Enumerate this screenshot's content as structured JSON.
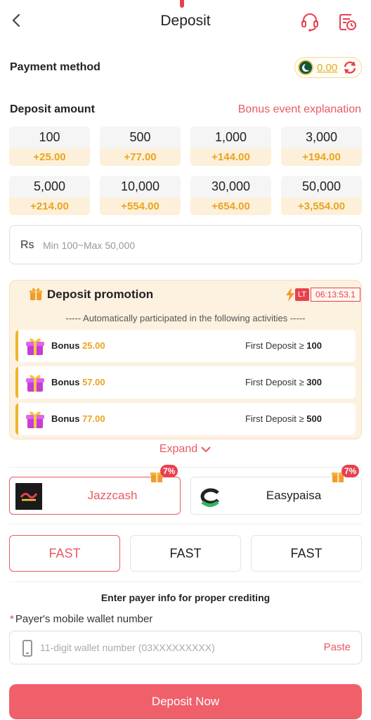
{
  "header": {
    "title": "Deposit",
    "icons": [
      "back-icon",
      "customer-service-icon",
      "history-icon"
    ]
  },
  "payment_method": {
    "label": "Payment method",
    "balance": "0.00",
    "flag_icon": "pakistan-flag-icon",
    "refresh_icon": "refresh-icon"
  },
  "deposit_amount": {
    "label": "Deposit amount",
    "bonus_link": "Bonus event explanation",
    "options": [
      {
        "amount": "100",
        "bonus": "+25.00"
      },
      {
        "amount": "500",
        "bonus": "+77.00"
      },
      {
        "amount": "1,000",
        "bonus": "+144.00"
      },
      {
        "amount": "3,000",
        "bonus": "+194.00"
      },
      {
        "amount": "5,000",
        "bonus": "+214.00"
      },
      {
        "amount": "10,000",
        "bonus": "+554.00"
      },
      {
        "amount": "30,000",
        "bonus": "+654.00"
      },
      {
        "amount": "50,000",
        "bonus": "+3,554.00"
      }
    ],
    "currency": "Rs",
    "placeholder": "Min 100~Max 50,000"
  },
  "promotion": {
    "title": "Deposit promotion",
    "badge": "LT",
    "countdown": "06:13:53.1",
    "subtitle": "----- Automatically participated in the following activities -----",
    "rows": [
      {
        "bonus_label": "Bonus",
        "bonus_value": "25.00",
        "condition": "First Deposit ≥",
        "threshold": "100"
      },
      {
        "bonus_label": "Bonus",
        "bonus_value": "57.00",
        "condition": "First Deposit ≥",
        "threshold": "300"
      },
      {
        "bonus_label": "Bonus",
        "bonus_value": "77.00",
        "condition": "First Deposit ≥",
        "threshold": "500"
      }
    ],
    "expand": "Expand"
  },
  "channels": [
    {
      "name": "Jazzcash",
      "rate": "7%",
      "selected": true
    },
    {
      "name": "Easypaisa",
      "rate": "7%",
      "selected": false
    }
  ],
  "fast_options": [
    {
      "label": "FAST",
      "selected": true
    },
    {
      "label": "FAST",
      "selected": false
    },
    {
      "label": "FAST",
      "selected": false
    }
  ],
  "payer": {
    "hint": "Enter payer info for proper crediting",
    "required_mark": "*",
    "wallet_label": "Payer's mobile wallet number",
    "wallet_placeholder": "11-digit wallet number (03XXXXXXXXX)",
    "paste": "Paste"
  },
  "submit": "Deposit Now",
  "colors": {
    "accent": "#e85a63",
    "gold": "#eaa41f",
    "promo_bg": "#fdf1e0"
  }
}
